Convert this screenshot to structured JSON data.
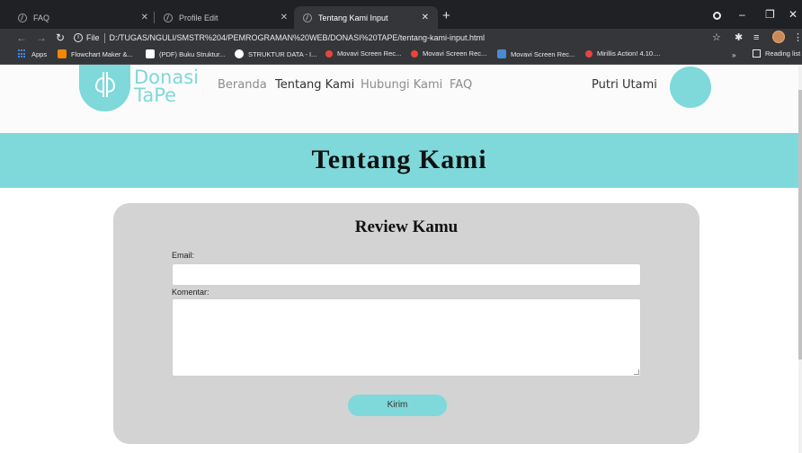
{
  "browser": {
    "tabs": [
      {
        "title": "FAQ",
        "active": false
      },
      {
        "title": "Profile Edit",
        "active": false
      },
      {
        "title": "Tentang Kami Input",
        "active": true
      }
    ],
    "address": {
      "scheme_label": "File",
      "url": "D:/TUGAS/NGULI/SMSTR%204/PEMROGRAMAN%20WEB/DONASI%20TAPE/tentang-kami-input.html"
    },
    "bookmarks": [
      {
        "label": "Apps",
        "icon": "apps-grid-icon"
      },
      {
        "label": "Flowchart Maker &...",
        "icon": "flowchart-icon",
        "color": "#f08705"
      },
      {
        "label": "(PDF) Buku Struktur...",
        "icon": "academia-icon",
        "color": "#ffffff"
      },
      {
        "label": "STRUKTUR DATA - I...",
        "icon": "google-icon",
        "color": "#ffffff"
      },
      {
        "label": "Movavi Screen Rec...",
        "icon": "movavi-icon",
        "color": "#e8453c"
      },
      {
        "label": "Movavi Screen Rec...",
        "icon": "movavi-icon",
        "color": "#e8453c"
      },
      {
        "label": "Movavi Screen Rec...",
        "icon": "movavi-alt-icon",
        "color": "#4a8ad4"
      },
      {
        "label": "Mirillis Action! 4.10....",
        "icon": "mirillis-icon",
        "color": "#e8453c"
      }
    ],
    "reading_list": "Reading list"
  },
  "site": {
    "brand_line1": "Donasi",
    "brand_line2": "TaPe",
    "nav": [
      {
        "label": "Beranda",
        "active": false
      },
      {
        "label": "Tentang Kami",
        "active": true
      },
      {
        "label": "Hubungi Kami",
        "active": false
      },
      {
        "label": "FAQ",
        "active": false
      }
    ],
    "user_name": "Putri Utami",
    "accent": "#7fd8da"
  },
  "hero": {
    "title": "Tentang Kami"
  },
  "review": {
    "title": "Review Kamu",
    "email_label": "Email:",
    "email_value": "",
    "comment_label": "Komentar:",
    "comment_value": "",
    "submit_label": "Kirim"
  }
}
